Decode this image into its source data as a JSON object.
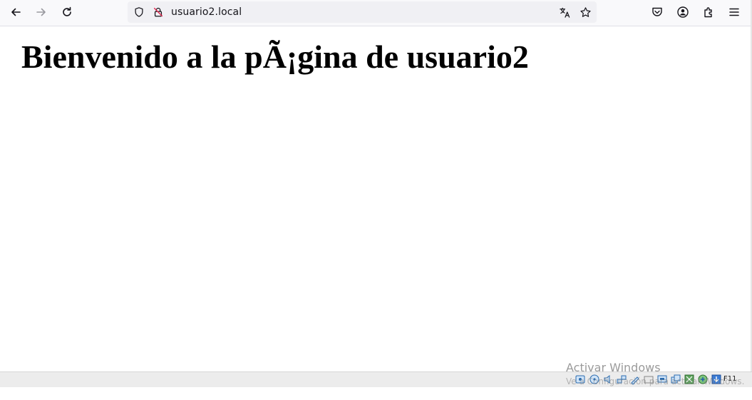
{
  "browser": {
    "url": "usuario2.local",
    "nav": {
      "back_icon": "arrow-left-icon",
      "forward_icon": "arrow-right-icon",
      "reload_icon": "reload-icon"
    },
    "urlbar_icons": [
      "shield-icon",
      "insecure-lock-icon",
      "translate-icon",
      "bookmark-star-icon"
    ],
    "right_icons": [
      "pocket-icon",
      "account-icon",
      "extensions-icon",
      "menu-icon"
    ]
  },
  "page": {
    "heading": "Bienvenido a la pÃ¡gina de usuario2"
  },
  "overlay": {
    "watermark_title": "Activar Windows",
    "watermark_subtitle": "Ve a Configuración para activar Windows.",
    "host_key": "F11"
  }
}
